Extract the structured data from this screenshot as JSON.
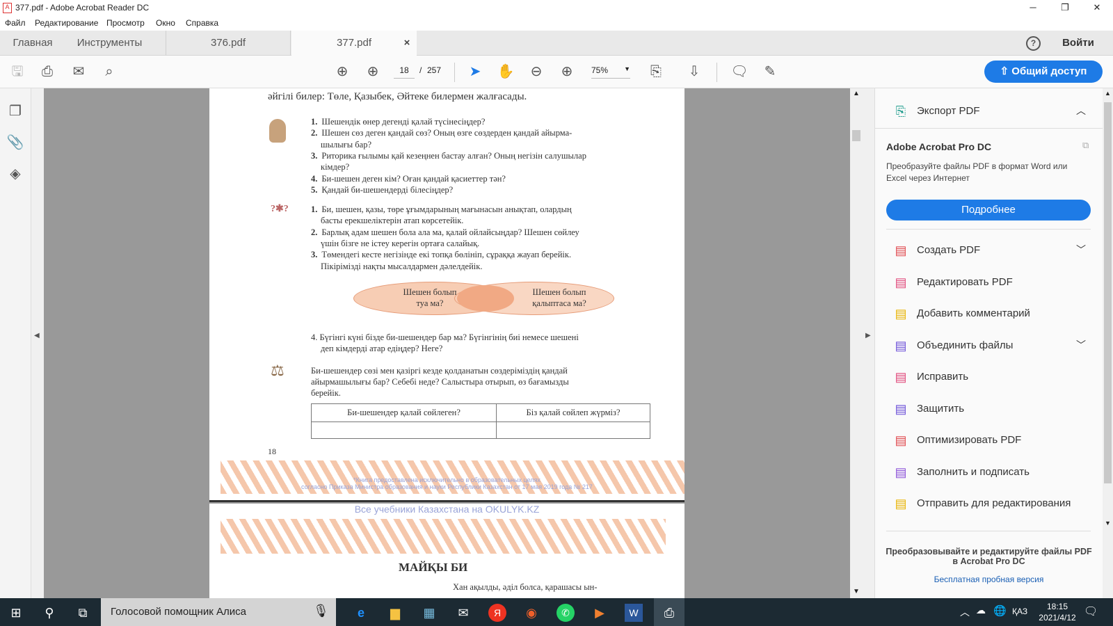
{
  "window": {
    "title": "377.pdf - Adobe Acrobat Reader DC"
  },
  "menu": [
    "Файл",
    "Редактирование",
    "Просмотр",
    "Окно",
    "Справка"
  ],
  "tabs": {
    "home": "Главная",
    "tools": "Инструменты",
    "doc1": "376.pdf",
    "doc2": "377.pdf",
    "close": "×",
    "signin": "Войти",
    "help": "?"
  },
  "toolbar": {
    "page_current": "18",
    "page_sep": "/",
    "page_total": "257",
    "zoom": "75%",
    "share": "Общий доступ"
  },
  "page": {
    "top_line": "әйгілі   билер:  Төле,  Қазыбек,   Әйтеке  билермен   жалғасады.",
    "q1": [
      {
        "n": "1.",
        "t": "Шешендік өнер дегенді қалай түсінесіңдер?"
      },
      {
        "n": "2.",
        "t": "Шешен сөз деген қандай сөз? Оның өзге сөздерден қандай айырма-"
      },
      {
        "n": "",
        "t": "шылығы бар?"
      },
      {
        "n": "3.",
        "t": "Риторика ғылымы қай кезеңнен бастау алған? Оның негізін салушылар"
      },
      {
        "n": "",
        "t": "кімдер?"
      },
      {
        "n": "4.",
        "t": "Би-шешен деген кім? Оған қандай қасиеттер тән?"
      },
      {
        "n": "5.",
        "t": "Қандай би-шешендерді білесіңдер?"
      }
    ],
    "q2": [
      {
        "n": "1.",
        "t": "Би, шешен, қазы, төре ұғымдарының мағынасын анықтап, олардың"
      },
      {
        "n": "",
        "t": "басты ерекшеліктерін атап көрсетейік."
      },
      {
        "n": "2.",
        "t": "Барлық адам шешен бола ала ма, қалай ойлайсыңдар? Шешен сөйлеу"
      },
      {
        "n": "",
        "t": "үшін бізге не істеу керегін ортаға салайық."
      },
      {
        "n": "3.",
        "t": "Төмендегі кесте негізінде екі топқа бөлініп, сұраққа жауап берейік."
      },
      {
        "n": "",
        "t": "Пікірімізді нақты мысалдармен дәлелдейік."
      }
    ],
    "venn_left": [
      "Шешен болып",
      "туа ма?"
    ],
    "venn_right": [
      "Шешен болып",
      "қалыптаса ма?"
    ],
    "q4": [
      "4. Бүгінгі күні бізде би-шешендер бар ма? Бүгінгінің биі немесе шешені",
      "деп кімдерді атар едіңдер? Неге?"
    ],
    "task": [
      "Би-шешендер сөзі мен қазіргі кезде қолданатын сөздеріміздің қандай",
      "айырмашылығы бар? Себебі неде? Салыстыра отырып, өз бағамызды",
      "берейік."
    ],
    "table_headers": [
      "Би-шешендер қалай сөйлеген?",
      "Біз қалай сөйлеп жүрміз?"
    ],
    "page_number": "18",
    "footer1": "*Книга предоставлена исключительно в образовательных целях",
    "footer2": "согласно Приказа Министра образования и науки Республики Казахстан от 17 мая 2019 года № 217",
    "watermark": "Все учебники Казахстана на OKULYK.KZ",
    "title2": "МАЙҚЫ  БИ",
    "p2line": "Хан ақылды,  әділ болса,  қарашасы ын-"
  },
  "panel": {
    "export": "Экспорт PDF",
    "product": "Adobe Acrobat Pro DC",
    "desc": [
      "Преобразуйте файлы PDF в формат Word или",
      "Excel через Интернет"
    ],
    "more": "Подробнее",
    "items": [
      {
        "label": "Создать PDF",
        "color": "#e0474c",
        "icon": "create-pdf-icon"
      },
      {
        "label": "Редактировать PDF",
        "color": "#e0477a",
        "icon": "edit-pdf-icon"
      },
      {
        "label": "Добавить комментарий",
        "color": "#e8b300",
        "icon": "comment-icon"
      },
      {
        "label": "Объединить файлы",
        "color": "#6b4fd8",
        "icon": "combine-icon"
      },
      {
        "label": "Исправить",
        "color": "#e0477a",
        "icon": "fix-icon"
      },
      {
        "label": "Защитить",
        "color": "#6b4fd8",
        "icon": "protect-icon"
      },
      {
        "label": "Оптимизировать PDF",
        "color": "#e0474c",
        "icon": "optimize-icon"
      },
      {
        "label": "Заполнить и подписать",
        "color": "#8a4fd8",
        "icon": "fill-sign-icon"
      },
      {
        "label": "Отправить для редактирования",
        "color": "#e8b300",
        "icon": "send-icon"
      }
    ],
    "promo": [
      "Преобразовывайте и редактируйте файлы PDF",
      "в Acrobat Pro DC"
    ],
    "trial": "Бесплатная пробная версия"
  },
  "taskbar": {
    "search": "Голосовой помощник Алиса",
    "lang": "ҚАЗ",
    "time": "18:15",
    "date": "2021/4/12"
  },
  "colors": {
    "accent": "#1e7be6",
    "ornament": "#f5c1a2"
  }
}
